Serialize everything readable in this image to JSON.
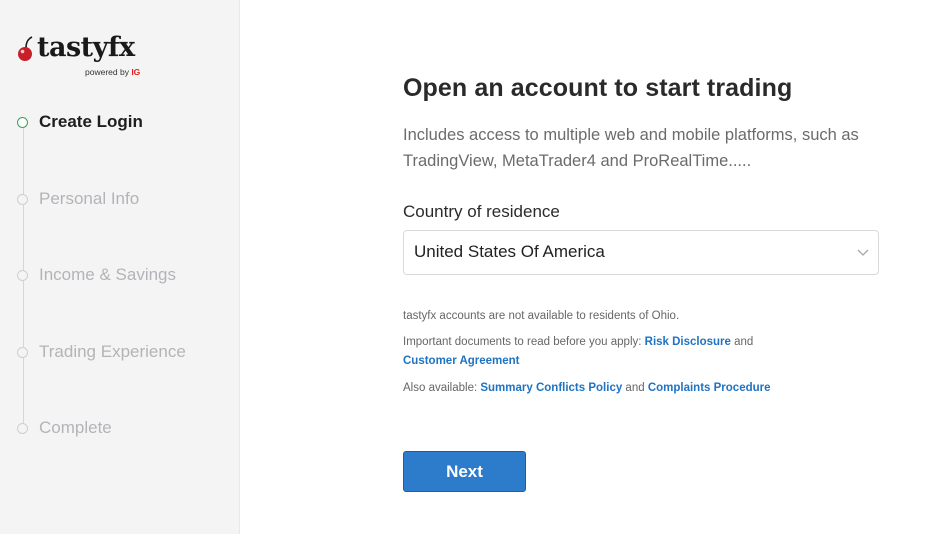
{
  "brand": {
    "name": "tastyfx",
    "powered_prefix": "powered by ",
    "powered_brand": "IG",
    "accent_color": "#3aa055",
    "link_color": "#1f73c2",
    "button_color": "#2d7ccc"
  },
  "steps": [
    {
      "label": "Create Login",
      "active": true
    },
    {
      "label": "Personal Info",
      "active": false
    },
    {
      "label": "Income & Savings",
      "active": false
    },
    {
      "label": "Trading Experience",
      "active": false
    },
    {
      "label": "Complete",
      "active": false
    }
  ],
  "main": {
    "title": "Open an account to start trading",
    "intro": "Includes access to multiple web and mobile platforms, such as TradingView, MetaTrader4 and ProRealTime.....",
    "country_label": "Country of residence",
    "country_value": "United States Of America",
    "notice_ohio": "tastyfx accounts are not available to residents of Ohio.",
    "docs_prefix": "Important documents to read before you apply: ",
    "risk_disclosure": "Risk Disclosure",
    "and_1": " and",
    "customer_agreement": "Customer Agreement",
    "also_prefix": "Also available: ",
    "conflicts_policy": "Summary Conflicts Policy",
    "and_2": " and ",
    "complaints_procedure": "Complaints Procedure",
    "next_label": "Next"
  }
}
